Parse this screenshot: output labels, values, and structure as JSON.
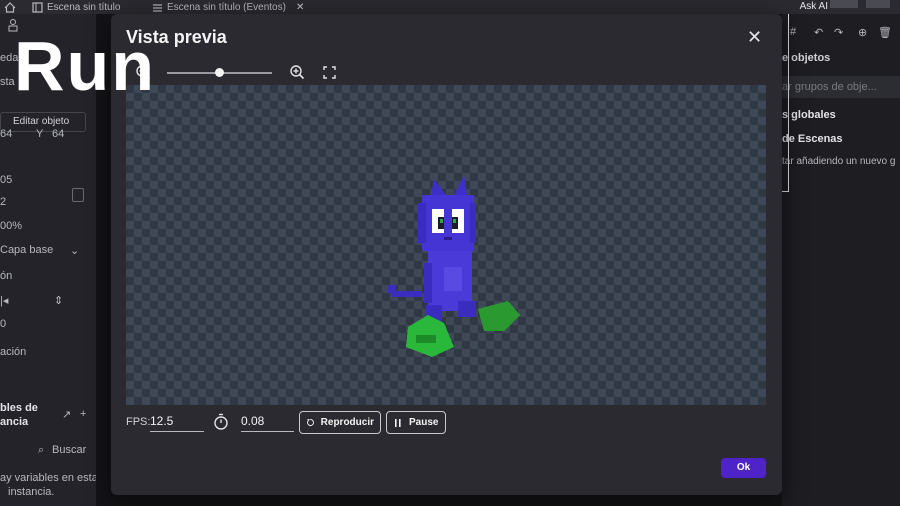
{
  "tabs": [
    {
      "label": "Escena sin título"
    },
    {
      "label": "Escena sin título (Eventos)"
    }
  ],
  "askai_label": "Ask AI",
  "left_panel": {
    "row_a": "eda",
    "row_b": "sta",
    "edit_object_label": "Editar objeto",
    "x_value": "64",
    "y_label": "Y",
    "y_value": "64",
    "value_05": "05",
    "value_2": "2",
    "percent": "00%",
    "layer": "Capa base",
    "section_a": "ón",
    "value_0": "0",
    "section_b": "ación",
    "variables_title_1": "bles de",
    "variables_title_2": "ancia",
    "search_placeholder": "Buscar",
    "empty_1": "ay variables en esta",
    "empty_2": "instancia."
  },
  "right_panel": {
    "header": "e objetos",
    "search_placeholder": "ar grupos de obje...",
    "globals": "s globales",
    "scenes": "de Escenas",
    "hint": "tar añadiendo un nuevo g"
  },
  "modal": {
    "title": "Vista previa",
    "zoom_fraction": 0.5,
    "fps_label": "FPS:",
    "fps_value": "12.5",
    "time_value": "0.08",
    "play_label": "Reproducir",
    "pause_label": "Pause",
    "ok_label": "Ok"
  },
  "overlay_text": "Run",
  "colors": {
    "accent": "#4e23c8",
    "modal_bg": "#2a2a30",
    "checker_dark": "#303844",
    "checker_light": "#3f4856"
  }
}
